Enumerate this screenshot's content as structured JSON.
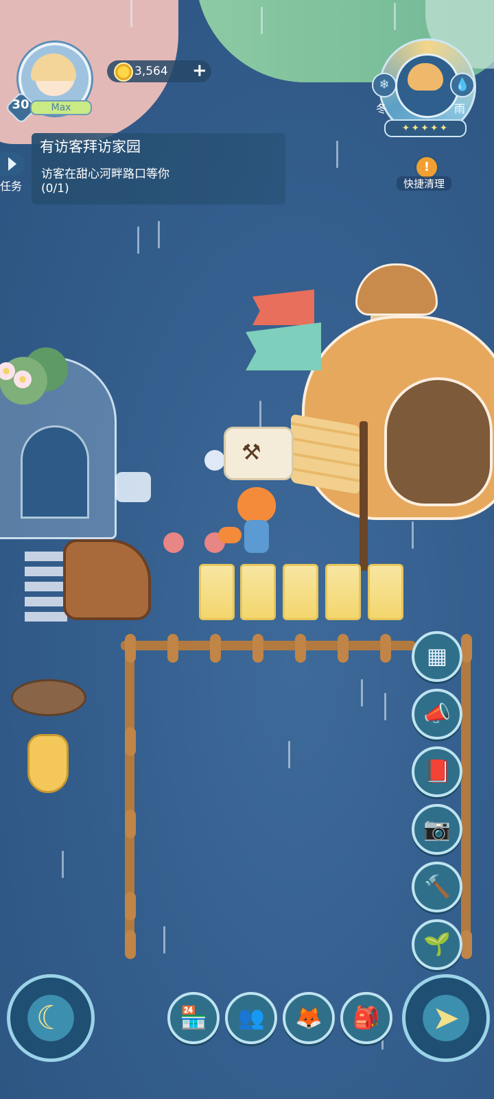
{
  "player": {
    "level": "30",
    "level_tag": "Max"
  },
  "currency": {
    "coins": "3,564",
    "add_label": "+"
  },
  "weather": {
    "season": "冬",
    "condition": "雨",
    "stars": "✦✦✦✦✦"
  },
  "quick_clean": {
    "icon": "!",
    "label": "快捷清理"
  },
  "quest": {
    "tab_label": "任务",
    "title": "有访客拜访家园",
    "description": "访客在甜心河畔路口等你",
    "progress": "(0/1)"
  },
  "speech_icon": "⚒",
  "icons": {
    "side": [
      "layout-icon",
      "megaphone-icon",
      "book-icon",
      "camera-icon",
      "hammer-icon",
      "sprout-icon"
    ],
    "bottom": [
      "shop-icon",
      "friends-icon",
      "character-icon",
      "backpack-icon"
    ]
  },
  "glyphs": {
    "layout": "▦",
    "megaphone": "📣",
    "book": "📕",
    "camera": "📷",
    "hammer": "🔨",
    "sprout": "🌱",
    "shop": "🏪",
    "friends": "👥",
    "character": "🦊",
    "backpack": "🎒",
    "compass": "➤",
    "moon": "☾"
  }
}
